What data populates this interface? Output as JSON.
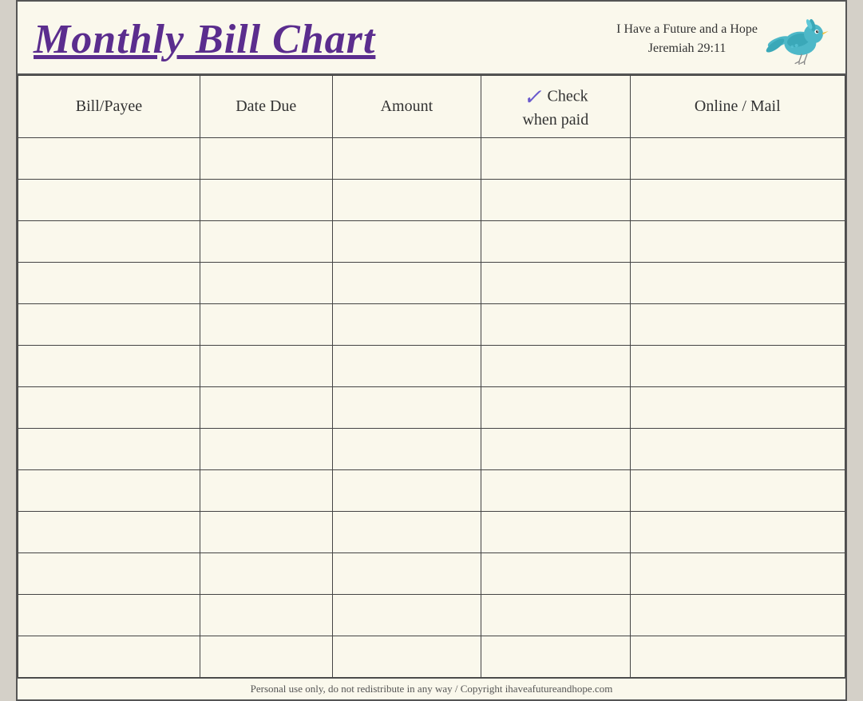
{
  "header": {
    "title": "Monthly Bill Chart",
    "tagline_line1": "I Have a Future and a Hope",
    "tagline_line2": "Jeremiah 29:11"
  },
  "table": {
    "columns": [
      {
        "id": "bill",
        "label": "Bill/Payee"
      },
      {
        "id": "date",
        "label": "Date Due"
      },
      {
        "id": "amount",
        "label": "Amount"
      },
      {
        "id": "check",
        "label": "when paid",
        "check_symbol": "✓",
        "prefix": "Check"
      },
      {
        "id": "online",
        "label": "Online / Mail"
      }
    ],
    "row_count": 13
  },
  "footer": {
    "text": "Personal use only, do not redistribute in any way / Copyright ihaveafutureandhope.com"
  }
}
